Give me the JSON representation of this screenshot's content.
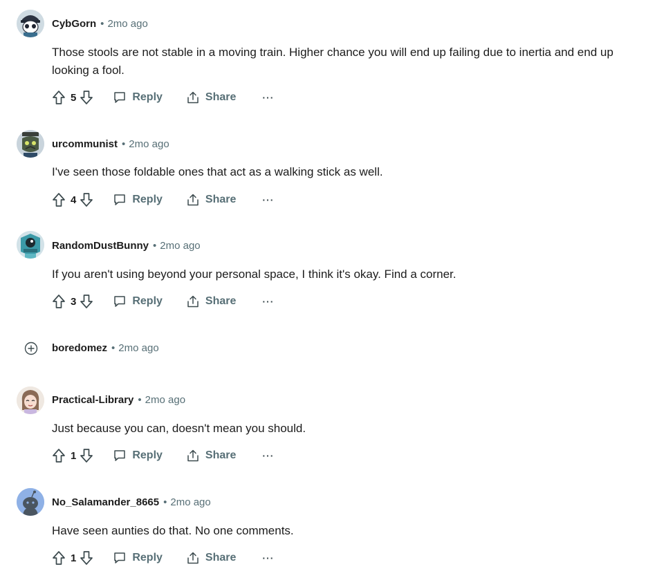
{
  "comments": [
    {
      "username": "CybGorn",
      "time": "2mo ago",
      "body_lines": [
        "Those stools are not stable in a moving train. Higher chance you will end up failing due to inertia and end up",
        "looking a fool."
      ],
      "score": "5",
      "reply_label": "Reply",
      "share_label": "Share",
      "more_label": "···"
    },
    {
      "username": "urcommunist",
      "time": "2mo ago",
      "body_lines": [
        "I've seen those foldable ones that act as a walking stick as well."
      ],
      "score": "4",
      "reply_label": "Reply",
      "share_label": "Share",
      "more_label": "···"
    },
    {
      "username": "RandomDustBunny",
      "time": "2mo ago",
      "body_lines": [
        "If you aren't using beyond your personal space, I think it's okay. Find a corner."
      ],
      "score": "3",
      "reply_label": "Reply",
      "share_label": "Share",
      "more_label": "···"
    },
    {
      "username": "boredomez",
      "time": "2mo ago",
      "collapsed": true
    },
    {
      "username": "Practical-Library",
      "time": "2mo ago",
      "body_lines": [
        "Just because you can, doesn't mean you should."
      ],
      "score": "1",
      "reply_label": "Reply",
      "share_label": "Share",
      "more_label": "···"
    },
    {
      "username": "No_Salamander_8665",
      "time": "2mo ago",
      "body_lines": [
        "Have seen aunties do that. No one comments."
      ],
      "score": "1",
      "reply_label": "Reply",
      "share_label": "Share",
      "more_label": "···"
    }
  ],
  "separator": "•",
  "icons": {
    "upvote": "upvote-icon",
    "downvote": "downvote-icon",
    "reply": "comment-bubble-icon",
    "share": "share-icon",
    "expand": "plus-circle-icon"
  },
  "colors": {
    "text": "#1c1c1c",
    "meta": "#576f76",
    "icon": "#3c4a4e",
    "default_avatar": "#8fb1e6"
  }
}
